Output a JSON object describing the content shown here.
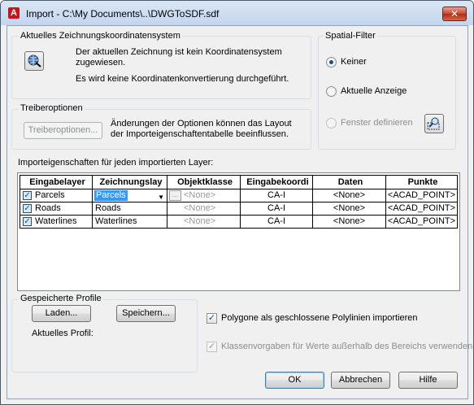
{
  "window": {
    "title": "Import - C:\\My Documents\\..\\DWGToSDF.sdf",
    "app_icon_letter": "A",
    "close_symbol": "✕"
  },
  "coord_system": {
    "group_label": "Aktuelles Zeichnungskoordinatensystem",
    "line1": "Der aktuellen Zeichnung ist kein Koordinatensystem",
    "line2": "zugewiesen.",
    "line3": "Es wird keine Koordinatenkonvertierung durchgeführt."
  },
  "spatial_filter": {
    "group_label": "Spatial-Filter",
    "options": [
      {
        "label": "Keiner",
        "checked": true,
        "enabled": true
      },
      {
        "label": "Aktuelle Anzeige",
        "checked": false,
        "enabled": true
      },
      {
        "label": "Fenster definieren",
        "checked": false,
        "enabled": false
      }
    ]
  },
  "driver": {
    "group_label": "Treiberoptionen",
    "button_label": "Treiberoptionen...",
    "note_line1": "Änderungen der Optionen können das Layout",
    "note_line2": "der Importeigenschaftentabelle beeinflussen."
  },
  "layers": {
    "label": "Importeigenschaften für jeden importierten Layer:",
    "columns": [
      "Eingabelayer",
      "Zeichnungslay",
      "Objektklasse",
      "Eingabekoordi",
      "Daten",
      "Punkte"
    ],
    "rows": [
      {
        "checked": true,
        "input_layer": "Parcels",
        "drawing_layer": "Parcels",
        "object_class": "<None>",
        "coord": "CA-I",
        "data": "<None>",
        "points": "<ACAD_POINT>"
      },
      {
        "checked": true,
        "input_layer": "Roads",
        "drawing_layer": "Roads",
        "object_class": "<None>",
        "coord": "CA-I",
        "data": "<None>",
        "points": "<ACAD_POINT>"
      },
      {
        "checked": true,
        "input_layer": "Waterlines",
        "drawing_layer": "Waterlines",
        "object_class": "<None>",
        "coord": "CA-I",
        "data": "<None>",
        "points": "<ACAD_POINT>"
      }
    ],
    "ellipsis": "..."
  },
  "profiles": {
    "group_label": "Gespeicherte Profile",
    "load_label": "Laden...",
    "save_label": "Speichern...",
    "current_label": "Aktuelles Profil:"
  },
  "options": {
    "polygons_label": "Polygone als geschlossene Polylinien importieren",
    "polygons_checked": true,
    "class_defaults_label": "Klassenvorgaben für Werte außerhalb des Bereichs verwenden",
    "class_defaults_checked": true,
    "class_defaults_enabled": false
  },
  "buttons": {
    "ok": "OK",
    "cancel": "Abbrechen",
    "help": "Hilfe"
  },
  "check_mark": "✓",
  "colors": {
    "accent": "#1b4f8a",
    "selection": "#3399ff",
    "close_button": "#c7452f"
  }
}
